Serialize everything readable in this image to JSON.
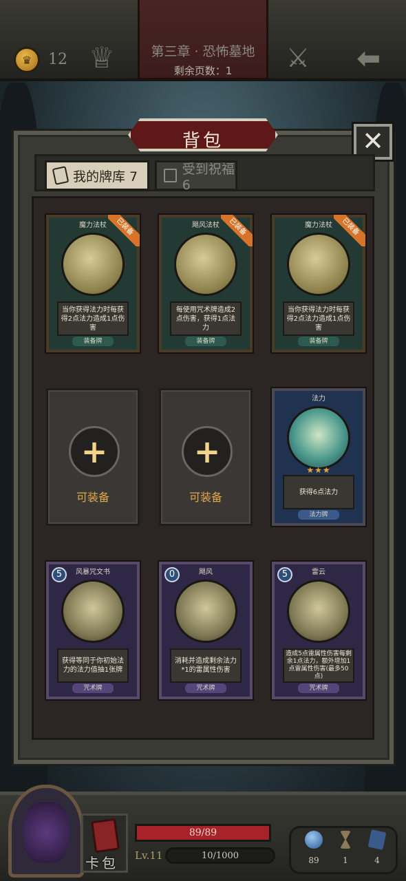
{
  "header": {
    "coin_count": "12",
    "chapter_title": "第三章 · 恐怖墓地",
    "pages_left": "剩余页数：1"
  },
  "dialog": {
    "title": "背包",
    "close": "✕",
    "tabs": [
      {
        "label": "我的牌库 7"
      },
      {
        "label": "受到祝福 6"
      }
    ]
  },
  "cards": [
    {
      "name": "魔力法杖",
      "desc": "当你获得法力时每获得2点法力造成1点伤害",
      "type": "装备牌",
      "badge": "已装备"
    },
    {
      "name": "飓风法杖",
      "desc": "每使用咒术牌造成2点伤害，获得1点法力",
      "type": "装备牌",
      "badge": "已装备"
    },
    {
      "name": "魔力法杖",
      "desc": "当你获得法力时每获得2点法力造成1点伤害",
      "type": "装备牌",
      "badge": "已装备"
    },
    {
      "name": "法力",
      "desc": "获得6点法力",
      "type": "法力牌",
      "stars": "★★★"
    },
    {
      "name": "风暴咒文书",
      "desc": "获得等同于你初始法力的法力值抽1张牌",
      "type": "咒术牌",
      "cost": "5"
    },
    {
      "name": "飓风",
      "desc": "消耗并造成剩余法力*1的雷属性伤害",
      "type": "咒术牌",
      "cost": "0"
    },
    {
      "name": "雷云",
      "desc": "造成5点雷属性伤害每剩余1点法力，额外增加1点雷属性伤害(最多50点)",
      "type": "咒术牌",
      "cost": "5"
    }
  ],
  "empty_slot": {
    "plus": "+",
    "label": "可装备"
  },
  "footer": {
    "deck_label": "卡包",
    "hp": "89/89",
    "hp_fraction": 1.0,
    "level": "Lv.11",
    "xp": "10/1000",
    "resources": [
      {
        "icon": "mana-orb-icon",
        "value": "89"
      },
      {
        "icon": "hourglass-icon",
        "value": "1"
      },
      {
        "icon": "cards-icon",
        "value": "4"
      }
    ]
  },
  "colors": {
    "accent": "#a8222a",
    "gold": "#e2a94a"
  }
}
